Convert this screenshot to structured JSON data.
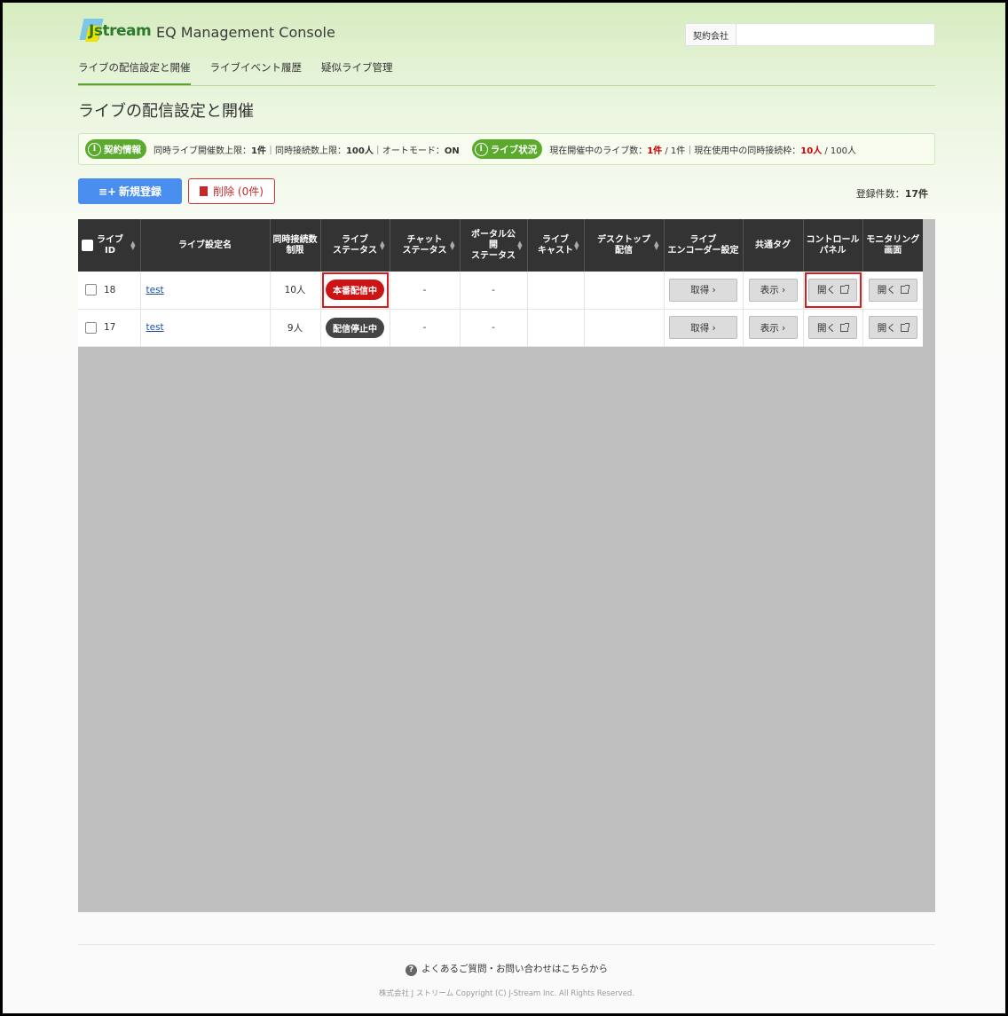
{
  "header": {
    "logo_text": "Jstream",
    "app_title": "EQ Management Console",
    "contract_label": "契約会社",
    "contract_value": ""
  },
  "nav": {
    "items": [
      {
        "label": "ライブの配信設定と開催",
        "active": true
      },
      {
        "label": "ライブイベント履歴",
        "active": false
      },
      {
        "label": "疑似ライブ管理",
        "active": false
      }
    ]
  },
  "page_title": "ライブの配信設定と開催",
  "info": {
    "contract_pill": "契約情報",
    "contract_text_pre": "同時ライブ開催数上限：",
    "contract_limit": "1件",
    "contract_sep1": "｜同時接続数上限：",
    "contract_conn": "100人",
    "contract_sep2": "｜オートモード：",
    "auto_mode": "ON",
    "live_pill": "ライブ状況",
    "live_text_pre": "現在開催中のライブ数：",
    "live_count": "1件",
    "live_total": " / 1件",
    "live_sep": "｜現在使用中の同時接続枠：",
    "conn_used": "10人",
    "conn_total": " / 100人"
  },
  "actions": {
    "new_label": "新規登録",
    "delete_label": "削除 (0件)",
    "count_label": "登録件数：",
    "count_value": "17件"
  },
  "table": {
    "headers": {
      "id": [
        "ライブ",
        "ID"
      ],
      "name": "ライブ設定名",
      "limit": [
        "同時接続数",
        "制限"
      ],
      "status": [
        "ライブ",
        "ステータス"
      ],
      "chat": [
        "チャット",
        "ステータス"
      ],
      "portal": [
        "ポータル公",
        "開",
        "ステータス"
      ],
      "cast": [
        "ライブ",
        "キャスト"
      ],
      "desktop": [
        "デスクトップ",
        "配信"
      ],
      "encoder": [
        "ライブ",
        "エンコーダー設定"
      ],
      "tag": "共通タグ",
      "control": [
        "コントロール",
        "パネル"
      ],
      "monitor": [
        "モニタリング",
        "画面"
      ]
    },
    "rows": [
      {
        "id": "18",
        "name": "test",
        "limit": "10人",
        "status": "本番配信中",
        "status_type": "live",
        "chat": "-",
        "portal": "-",
        "cast": "",
        "desktop": "",
        "encoder": "取得 ›",
        "tag": "表示 ›",
        "control": "開く",
        "monitor": "開く"
      },
      {
        "id": "17",
        "name": "test",
        "limit": "9人",
        "status": "配信停止中",
        "status_type": "stop",
        "chat": "-",
        "portal": "-",
        "cast": "",
        "desktop": "",
        "encoder": "取得 ›",
        "tag": "表示 ›",
        "control": "開く",
        "monitor": "開く"
      }
    ]
  },
  "footer": {
    "faq": "よくあるご質問・お問い合わせはこちらから",
    "copyright": "株式会社 J ストリーム Copyright (C) J-Stream Inc. All Rights Reserved."
  },
  "colors": {
    "accent_green": "#5aab2d",
    "primary_blue": "#4a8ff0",
    "danger_red": "#cc1414"
  }
}
